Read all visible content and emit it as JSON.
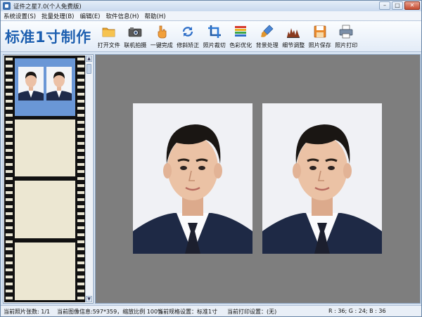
{
  "window": {
    "title": "证件之星7.0(个人免费版)",
    "controls": [
      "–",
      "□",
      "✕"
    ]
  },
  "menu": [
    "系统设置(S)",
    "批量处理(B)",
    "编辑(E)",
    "软件信息(H)",
    "帮助(H)"
  ],
  "toolbar": {
    "brand": "标准1寸制作",
    "tools": [
      {
        "label": "打开文件",
        "icon": "folder-icon"
      },
      {
        "label": "联机拍摄",
        "icon": "camera-icon"
      },
      {
        "label": "一键完成",
        "icon": "hand-icon"
      },
      {
        "label": "修斜矫正",
        "icon": "rotate-icon"
      },
      {
        "label": "照片裁切",
        "icon": "crop-icon"
      },
      {
        "label": "色彩优化",
        "icon": "color-bars-icon"
      },
      {
        "label": "背景处理",
        "icon": "brush-icon"
      },
      {
        "label": "细节调整",
        "icon": "levels-icon"
      },
      {
        "label": "照片保存",
        "icon": "floppy-icon"
      },
      {
        "label": "照片打印",
        "icon": "printer-icon"
      }
    ]
  },
  "status": {
    "count": "当前照片张数: 1/1",
    "image_info": "当前图像信息:597*359，缩放比例 100%",
    "spec": "当前规格设置：标准1寸",
    "print": "当前打印设置：(无)",
    "rgb": "R : 36; G : 24; B : 36"
  },
  "colors": {
    "brand": "#1d5fb0",
    "canvas_bg": "#7e7e7e",
    "selected_frame": "#6a97d6",
    "film_frame": "#ece7d2"
  }
}
